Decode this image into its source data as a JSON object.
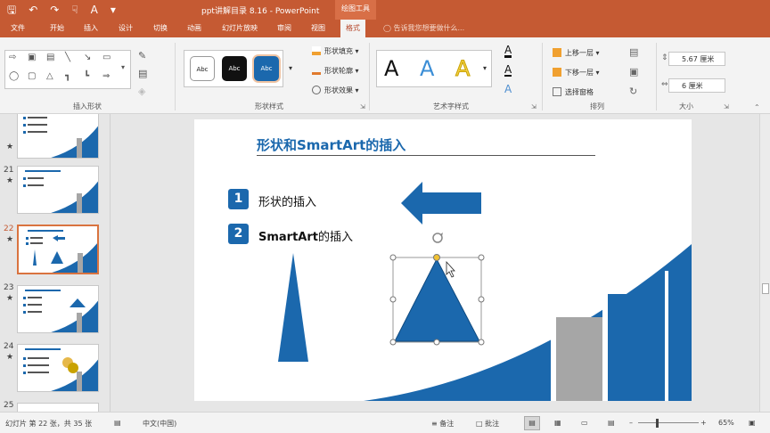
{
  "app": {
    "title": "ppt讲解目录 8.16 - PowerPoint",
    "context_group": "绘图工具"
  },
  "tabs": [
    "文件",
    "开始",
    "插入",
    "设计",
    "切换",
    "动画",
    "幻灯片放映",
    "审阅",
    "视图",
    "格式"
  ],
  "active_tab": "格式",
  "tell_me": "告诉我您想要做什么...",
  "ribbon": {
    "groups": {
      "insert_shapes": "插入形状",
      "shape_styles": "形状样式",
      "wordart_styles": "艺术字样式",
      "arrange": "排列",
      "size": "大小"
    },
    "style_gallery": [
      "Abc",
      "Abc",
      "Abc"
    ],
    "shape_fill": "形状填充",
    "shape_outline": "形状轮廓",
    "shape_effects": "形状效果",
    "wordart_letters": [
      "A",
      "A",
      "A"
    ],
    "bring_forward": "上移一层",
    "send_backward": "下移一层",
    "selection_pane": "选择窗格",
    "height_value": "5.67 厘米",
    "width_value": "6 厘米"
  },
  "thumbnails": [
    {
      "num": "",
      "star": "★"
    },
    {
      "num": "21",
      "star": "★"
    },
    {
      "num": "22",
      "star": "★",
      "active": true
    },
    {
      "num": "23",
      "star": "★"
    },
    {
      "num": "24",
      "star": "★"
    },
    {
      "num": "25",
      "star": ""
    }
  ],
  "slide": {
    "title": "形状和SmartArt的插入",
    "items": [
      {
        "number": "1",
        "text": "形状的插入"
      },
      {
        "number": "2",
        "text_bold": "SmartArt",
        "text_rest": "的插入"
      }
    ]
  },
  "colors": {
    "accent": "#c55a33",
    "slide_blue": "#1b68ad",
    "gray_bar": "#a6a6a6"
  },
  "status": {
    "slide_info": "幻灯片 第 22 张，共 35 张",
    "language": "中文(中国)",
    "notes": "备注",
    "comments": "批注",
    "zoom": "65%"
  }
}
